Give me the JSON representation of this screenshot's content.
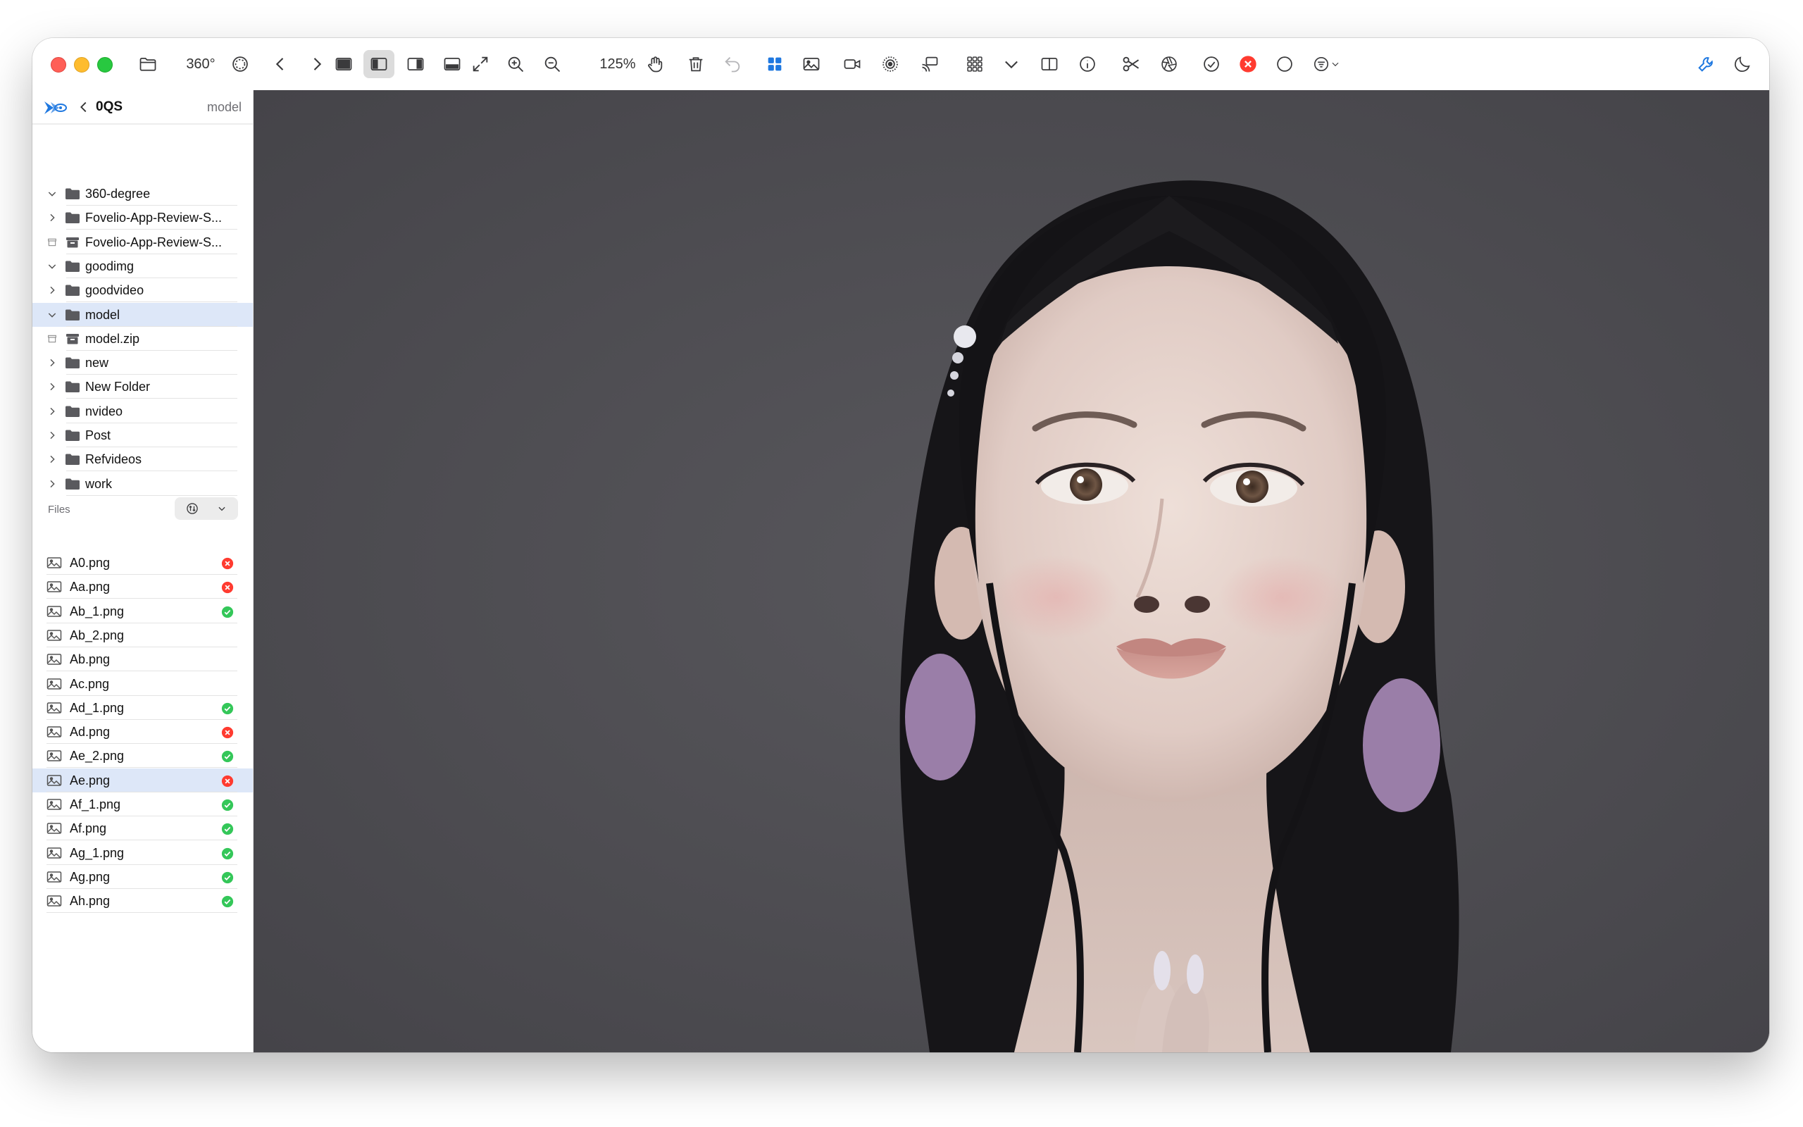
{
  "toolbar": {
    "view_360_label": "360°",
    "zoom_level": "125%"
  },
  "sidebar": {
    "header": {
      "title": "0QS",
      "current_folder": "model"
    },
    "folders": [
      {
        "name": "360-degree",
        "state": "expanded",
        "kind": "folder"
      },
      {
        "name": "Fovelio-App-Review-S...",
        "state": "collapsed",
        "kind": "folder"
      },
      {
        "name": "Fovelio-App-Review-S...",
        "state": "none",
        "kind": "archive"
      },
      {
        "name": "goodimg",
        "state": "expanded",
        "kind": "folder"
      },
      {
        "name": "goodvideo",
        "state": "collapsed",
        "kind": "folder"
      },
      {
        "name": "model",
        "state": "expanded",
        "kind": "folder",
        "selected": true
      },
      {
        "name": "model.zip",
        "state": "none",
        "kind": "archive"
      },
      {
        "name": "new",
        "state": "collapsed",
        "kind": "folder"
      },
      {
        "name": "New Folder",
        "state": "collapsed",
        "kind": "folder"
      },
      {
        "name": "nvideo",
        "state": "collapsed",
        "kind": "folder"
      },
      {
        "name": "Post",
        "state": "collapsed",
        "kind": "folder"
      },
      {
        "name": "Refvideos",
        "state": "collapsed",
        "kind": "folder"
      },
      {
        "name": "work",
        "state": "collapsed",
        "kind": "folder"
      }
    ],
    "files_label": "Files",
    "files": [
      {
        "name": "A0.png",
        "status": "rejected"
      },
      {
        "name": "Aa.png",
        "status": "rejected"
      },
      {
        "name": "Ab_1.png",
        "status": "accepted"
      },
      {
        "name": "Ab_2.png",
        "status": "none"
      },
      {
        "name": "Ab.png",
        "status": "none"
      },
      {
        "name": "Ac.png",
        "status": "none"
      },
      {
        "name": "Ad_1.png",
        "status": "accepted"
      },
      {
        "name": "Ad.png",
        "status": "rejected"
      },
      {
        "name": "Ae_2.png",
        "status": "accepted"
      },
      {
        "name": "Ae.png",
        "status": "rejected",
        "selected": true
      },
      {
        "name": "Af_1.png",
        "status": "accepted"
      },
      {
        "name": "Af.png",
        "status": "accepted"
      },
      {
        "name": "Ag_1.png",
        "status": "accepted"
      },
      {
        "name": "Ag.png",
        "status": "accepted"
      },
      {
        "name": "Ah.png",
        "status": "accepted"
      }
    ]
  },
  "colors": {
    "accent": "#1f78e0",
    "selection": "#dde7f8",
    "accepted": "#34c759",
    "rejected": "#ff3b30",
    "viewer_bg": "#4e4d52"
  }
}
